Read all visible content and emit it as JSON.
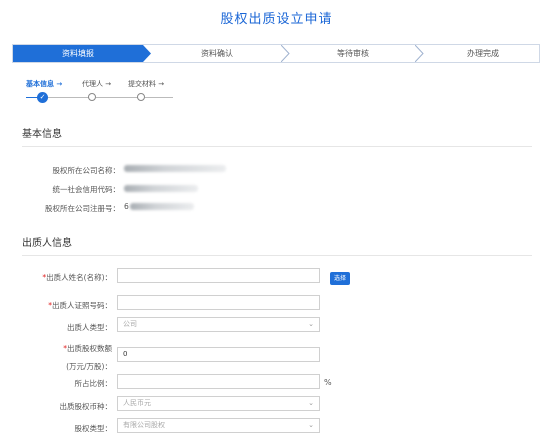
{
  "page": {
    "title": "股权出质设立申请"
  },
  "steps": [
    {
      "label": "资料填报",
      "active": true
    },
    {
      "label": "资料确认",
      "active": false
    },
    {
      "label": "等待审核",
      "active": false
    },
    {
      "label": "办理完成",
      "active": false
    }
  ],
  "sub_steps": [
    {
      "label": "基本信息 →",
      "active": true
    },
    {
      "label": "代理人 →",
      "active": false
    },
    {
      "label": "提交材料 →",
      "active": false
    }
  ],
  "basic_info": {
    "title": "基本信息",
    "rows": [
      {
        "label": "股权所在公司名称："
      },
      {
        "label": "统一社会信用代码："
      },
      {
        "label": "股权所在公司注册号：",
        "prefix": "6"
      }
    ]
  },
  "pledgor_info": {
    "title": "出质人信息",
    "fields": {
      "name_label": "*出质人姓名(名称)：",
      "pick_button": "选择",
      "id_label": "*出质人证照号码：",
      "type_label": "出质人类型：",
      "type_value": "公司",
      "amount_label_1": "*出质股权数额",
      "amount_label_2": "(万元/万股)：",
      "amount_value": "0",
      "ratio_label": "所占比例：",
      "ratio_unit": "%",
      "currency_label": "出质股权币种：",
      "currency_value": "人民币元",
      "equity_type_label": "股权类型：",
      "equity_type_value": "有限公司股权"
    }
  },
  "colors": {
    "accent": "#1f6fd8",
    "required": "#e02020"
  }
}
